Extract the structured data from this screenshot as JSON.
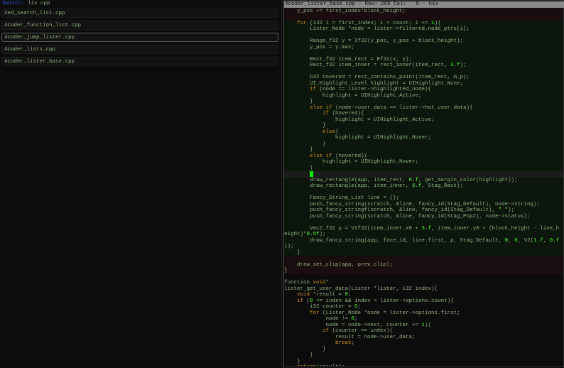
{
  "lister": {
    "query_label": "Switch:",
    "query_text": "lis cpp",
    "items": [
      {
        "label": "4ed_search_list.cpp",
        "selected": false
      },
      {
        "label": "4coder_function_list.cpp",
        "selected": false
      },
      {
        "label": "4coder_jump_lister.cpp",
        "selected": true
      },
      {
        "label": "4coder_lists.cpp",
        "selected": false
      },
      {
        "label": "4coder_lister_base.cpp",
        "selected": false
      }
    ]
  },
  "editor": {
    "header": "4coder_lister_base.cpp - Row: 269 Col:   9 - nix",
    "cursor_line": 27,
    "cursor_col": 8,
    "colors": {
      "default": "#90b080",
      "keyword": "#d08f20",
      "number": "#50ff30",
      "cursor": "#00ee00"
    },
    "lines": [
      "    y_pos += first_index*block_height;",
      "",
      "    for (i32 i = first_index; i < count; i += 1){",
      "        Lister_Node *node = lister->filtered.node_ptrs[i];",
      "",
      "        Range_f32 y = If32(y_pos, y_pos + block_height);",
      "        y_pos = y.max;",
      "",
      "        Rect_f32 item_rect = Rf32(x, y);",
      "        Rect_f32 item_inner = rect_inner(item_rect, 3.f);",
      "",
      "        b32 hovered = rect_contains_point(item_rect, m_p);",
      "        UI_Highlight_Level highlight = UIHighlight_None;",
      "        if (node == lister->highlighted_node){",
      "            highlight = UIHighlight_Active;",
      "        }",
      "        else if (node->user_data == lister->hot_user_data){",
      "            if (hovered){",
      "                highlight = UIHighlight_Active;",
      "            }",
      "            else{",
      "                highlight = UIHighlight_Hover;",
      "            }",
      "        }",
      "        else if (hovered){",
      "            highlight = UIHighlight_Hover;",
      "        }",
      "        ",
      "        draw_rectangle(app, item_rect, 6.f, get_margin_color(highlight));",
      "        draw_rectangle(app, item_inner, 6.f, Stag_Back);",
      "",
      "        Fancy_String_List line = {};",
      "        push_fancy_string(scratch, &line, fancy_id(Stag_Default), node->string);",
      "        push_fancy_stringf(scratch, &line, fancy_id(Stag_Default), \" \");",
      "        push_fancy_string(scratch, &line, fancy_id(Stag_Pop2), node->status);",
      "",
      "        Vec2_f32 p = V2f32(item_inner.x0 + 3.f, item_inner.y0 + (block_height - line_h",
      "eight)*0.5f);",
      "        draw_fancy_string(app, face_id, line.first, p, Stag_Default, 0, 0, V2(1.f, 0.f",
      "));",
      "    }",
      "",
      "    draw_set_clip(app, prev_clip);",
      "}",
      "",
      "function void*",
      "lister_get_user_data(Lister *lister, i32 index){",
      "    void *result = 0;",
      "    if (0 <= index && index < lister->options.count){",
      "        i32 counter = 0;",
      "        for (Lister_Node *node = lister->options.first;",
      "             node != 0;",
      "             node = node->next, counter += 1){",
      "            if (counter == index){",
      "                result = node->user_data;",
      "                break;",
      "            }",
      "        }",
      "    }",
      "    return(result);"
    ]
  }
}
